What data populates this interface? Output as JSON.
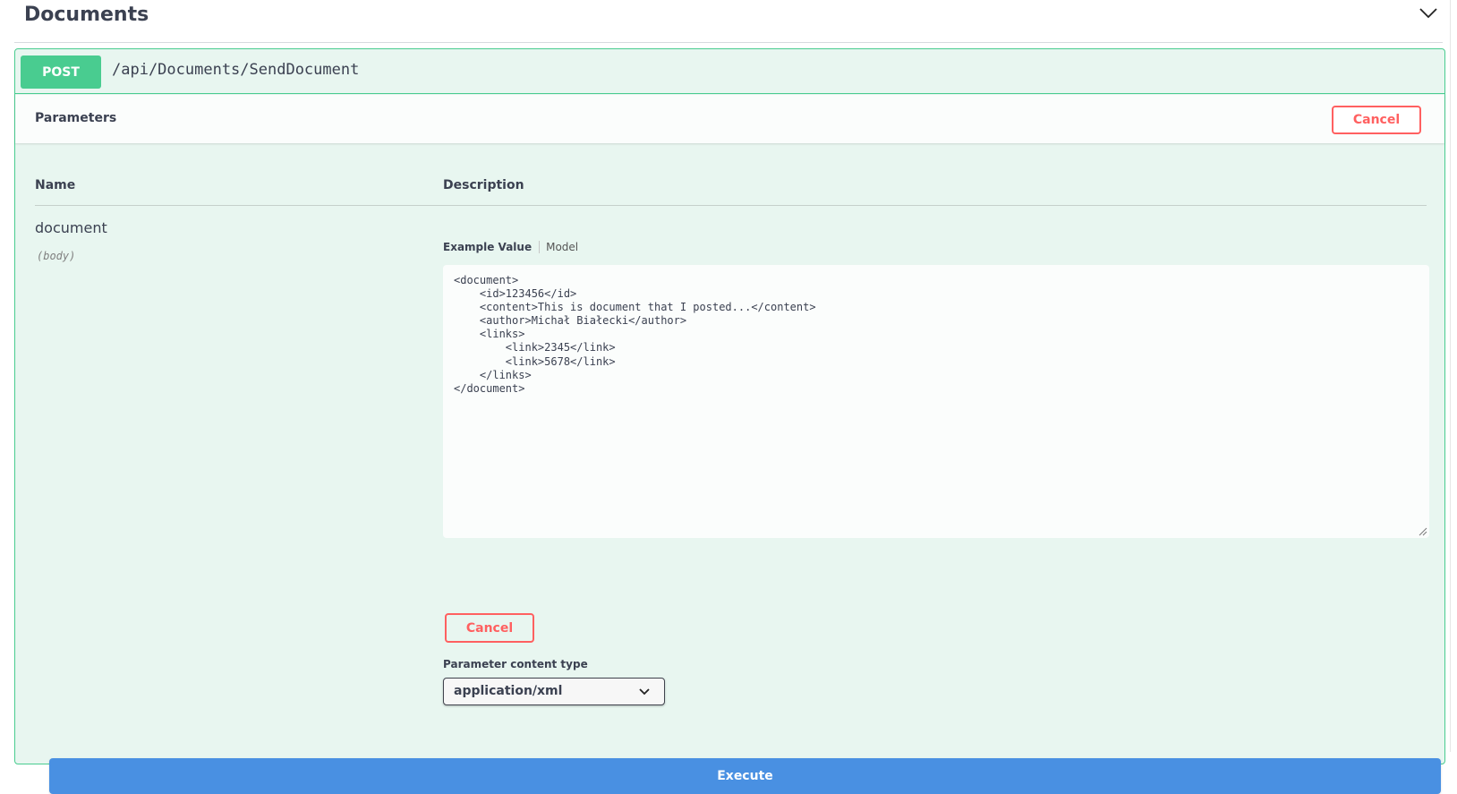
{
  "tag": {
    "title": "Documents"
  },
  "operation": {
    "method": "POST",
    "path": "/api/Documents/SendDocument",
    "parameters_title": "Parameters",
    "cancel_label": "Cancel"
  },
  "table": {
    "name_header": "Name",
    "description_header": "Description"
  },
  "parameter": {
    "name": "document",
    "in": "(body)",
    "tabs": {
      "example_value": "Example Value",
      "model": "Model"
    },
    "body": "<document>\n    <id>123456</id>\n    <content>This is document that I posted...</content>\n    <author>Michał Białecki</author>\n    <links>\n        <link>2345</link>\n        <link>5678</link>\n    </links>\n</document>",
    "cancel_label": "Cancel",
    "content_type_label": "Parameter content type",
    "content_type_value": "application/xml"
  },
  "execute_label": "Execute",
  "colors": {
    "post": "#49cc90",
    "post_bg": "#e8f6f0",
    "cancel": "#ff6060",
    "execute": "#4990e2"
  }
}
